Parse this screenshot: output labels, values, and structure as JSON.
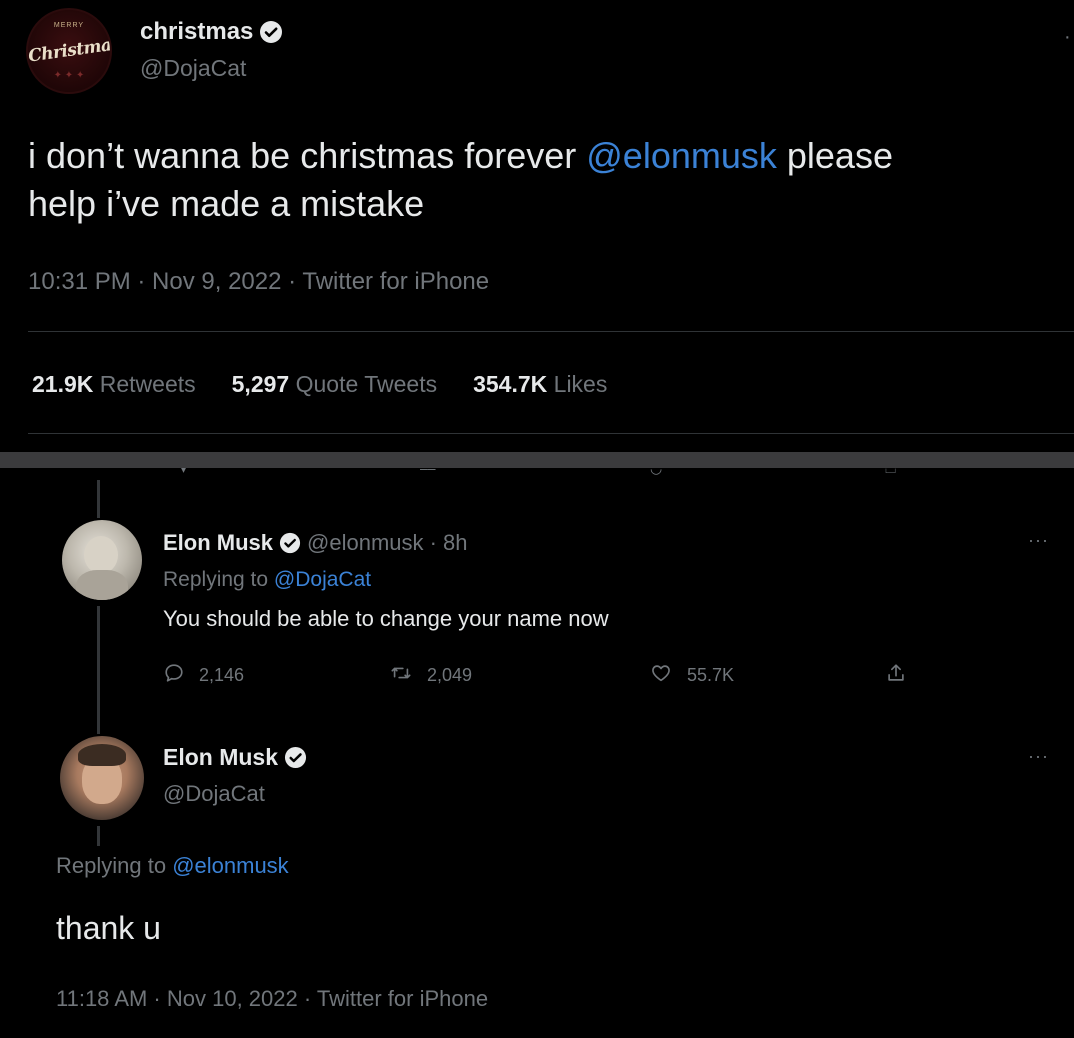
{
  "top_tweet": {
    "avatar_lettering": "Christmas",
    "avatar_small_lettering": "MERRY",
    "display_name": "christmas",
    "handle": "@DojaCat",
    "more_label": "·",
    "text_part1": "i don’t wanna be christmas forever ",
    "mention": "@elonmusk",
    "text_part2": " please",
    "text_line2": "help i’ve made a mistake",
    "meta": "10:31 PM · Nov 9, 2022 · Twitter for iPhone",
    "stats": {
      "retweets_count": "21.9K",
      "retweets_label": "Retweets",
      "quotes_count": "5,297",
      "quotes_label": "Quote Tweets",
      "likes_count": "354.7K",
      "likes_label": "Likes"
    }
  },
  "reply1": {
    "name": "Elon Musk",
    "handle_time": "@elonmusk · 8h",
    "replying_prefix": "Replying to ",
    "replying_handle": "@DojaCat",
    "text": "You should be able to change your name now",
    "reply_count": "2,146",
    "retweet_count": "2,049",
    "like_count": "55.7K",
    "more_label": "···"
  },
  "reply2": {
    "name": "Elon Musk",
    "handle": "@DojaCat",
    "replying_prefix": "Replying to ",
    "replying_handle": "@elonmusk",
    "text": "thank u",
    "meta": "11:18 AM · Nov 10, 2022 · Twitter for iPhone",
    "more_label": "···"
  },
  "colors": {
    "background": "#000000",
    "text": "#e7e9ea",
    "secondary": "#71767b",
    "link": "#3b82d6",
    "verified": "#e7e9ea"
  },
  "icons": [
    "verified-badge-icon",
    "reply-icon",
    "retweet-icon",
    "like-icon",
    "share-icon",
    "more-icon"
  ]
}
